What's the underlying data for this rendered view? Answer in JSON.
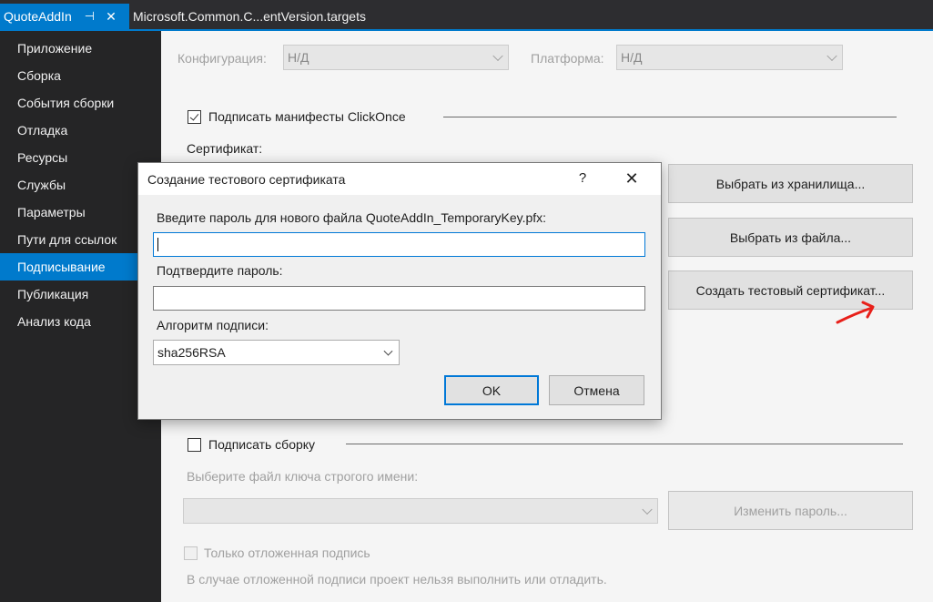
{
  "tabs": {
    "active": "QuoteAddIn",
    "active_pin": "⊣",
    "active_close": "✕",
    "second": "Microsoft.Common.C...entVersion.targets"
  },
  "sidebar": {
    "items": [
      {
        "label": "Приложение"
      },
      {
        "label": "Сборка"
      },
      {
        "label": "События сборки"
      },
      {
        "label": "Отладка"
      },
      {
        "label": "Ресурсы"
      },
      {
        "label": "Службы"
      },
      {
        "label": "Параметры"
      },
      {
        "label": "Пути для ссылок"
      },
      {
        "label": "Подписывание",
        "selected": true
      },
      {
        "label": "Публикация"
      },
      {
        "label": "Анализ кода"
      }
    ]
  },
  "main": {
    "config_label": "Конфигурация:",
    "config_value": "Н/Д",
    "platform_label": "Платформа:",
    "platform_value": "Н/Д",
    "sign_manifests_label": "Подписать манифесты ClickOnce",
    "sign_manifests_checked": true,
    "certificate_label": "Сертификат:",
    "btn_select_store": "Выбрать из хранилища...",
    "btn_select_file": "Выбрать из файла...",
    "btn_create_test": "Создать тестовый сертификат...",
    "sign_assembly_label": "Подписать сборку",
    "sign_assembly_checked": false,
    "strong_name_label": "Выберите файл ключа строгого имени:",
    "strong_name_value": "",
    "btn_change_password": "Изменить пароль...",
    "delay_sign_label": "Только отложенная подпись",
    "delay_sign_note": "В случае отложенной подписи проект нельзя выполнить или отладить."
  },
  "dialog": {
    "title": "Создание тестового сертификата",
    "help": "?",
    "close": "✕",
    "password_label": "Введите пароль для нового файла QuoteAddIn_TemporaryKey.pfx:",
    "password_value": "",
    "confirm_label": "Подтвердите пароль:",
    "confirm_value": "",
    "algo_label": "Алгоритм подписи:",
    "algo_value": "sha256RSA",
    "ok": "OK",
    "cancel": "Отмена"
  },
  "annotation": {
    "color": "#e8201a"
  }
}
